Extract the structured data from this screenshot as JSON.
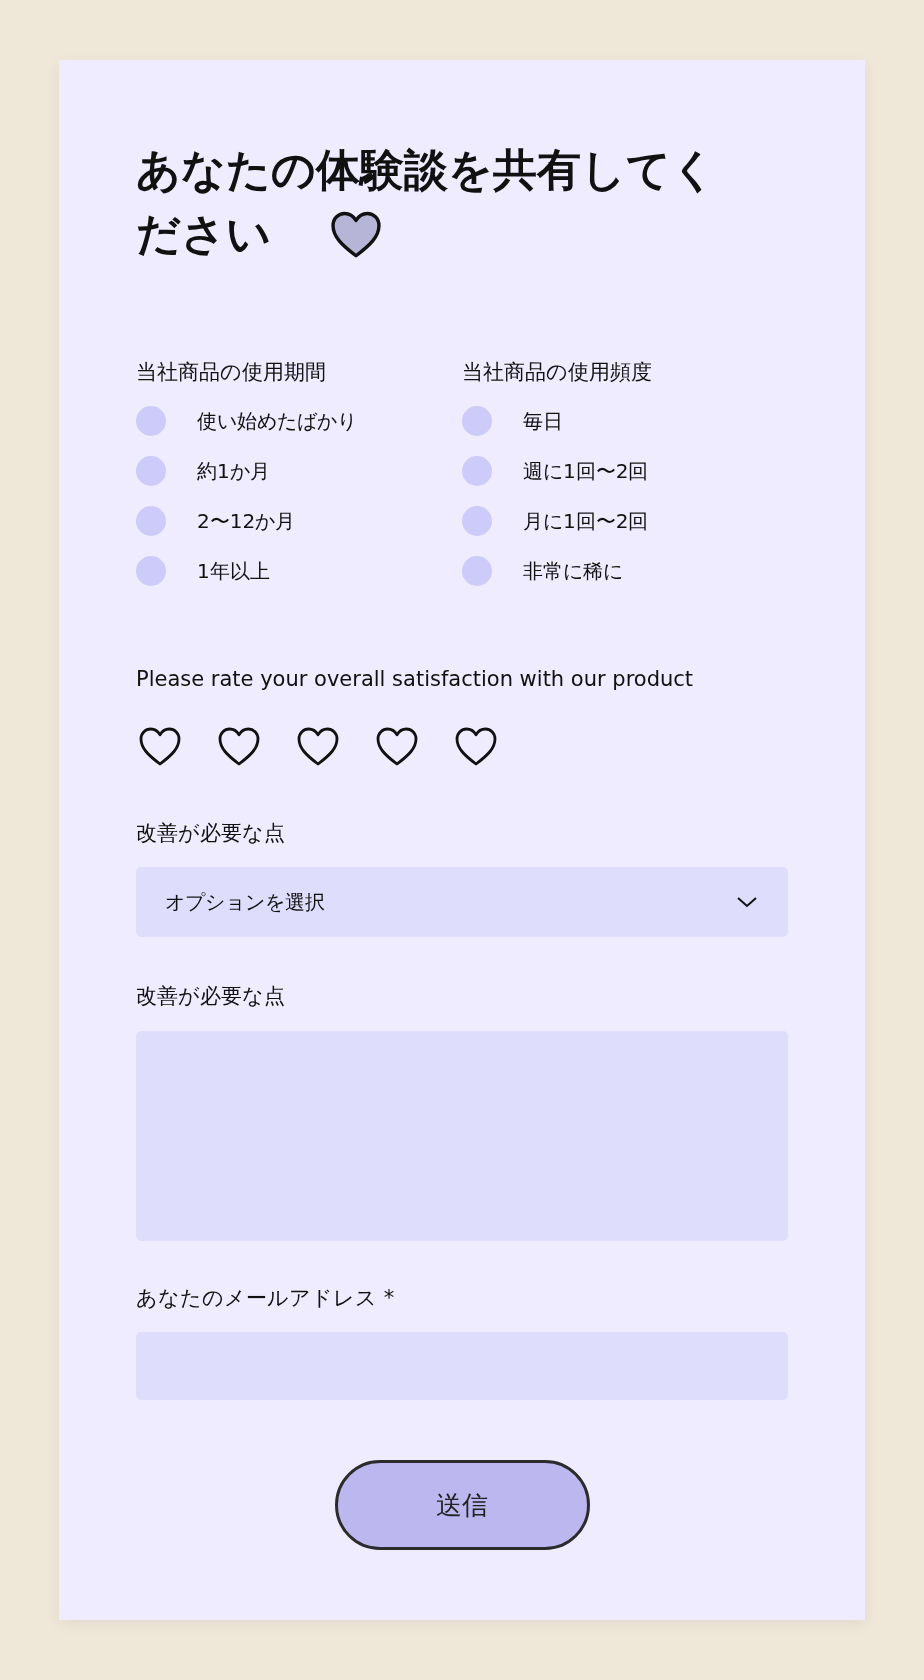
{
  "title_lines": [
    "あなたの体験談を共有してく",
    "ださい"
  ],
  "groups": [
    {
      "label": "当社商品の使用期間",
      "options": [
        {
          "label": "使い始めたばかり",
          "selected": false
        },
        {
          "label": "約1か月",
          "selected": false
        },
        {
          "label": "2〜12か月",
          "selected": false
        },
        {
          "label": "1年以上",
          "selected": false
        }
      ]
    },
    {
      "label": "当社商品の使用頻度",
      "options": [
        {
          "label": "毎日",
          "selected": false
        },
        {
          "label": "週に1回〜2回",
          "selected": false
        },
        {
          "label": "月に1回〜2回",
          "selected": false
        },
        {
          "label": "非常に稀に",
          "selected": false
        }
      ]
    }
  ],
  "rating": {
    "label": "Please rate your overall satisfaction with our product",
    "stars": 0
  },
  "select": {
    "label": "改善が必要な点",
    "placeholder": "オプションを選択"
  },
  "textarea": {
    "label": "改善が必要な点"
  },
  "email": {
    "label": "あなたのメールアドレス *"
  },
  "submit": "送信"
}
